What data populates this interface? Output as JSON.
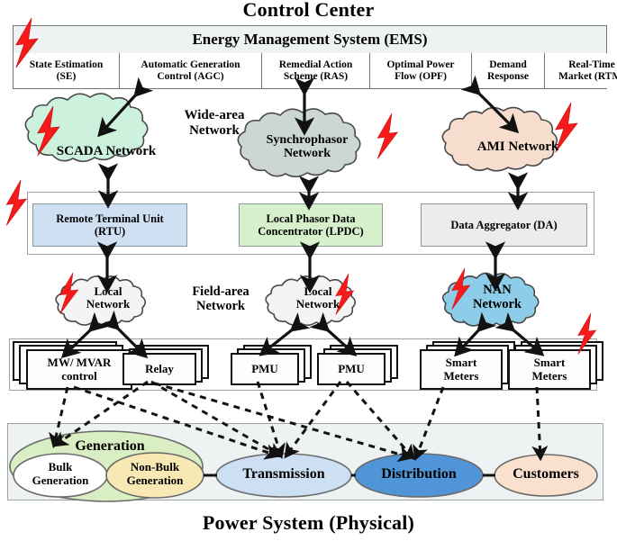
{
  "figure": {
    "top_title": "Control Center",
    "bottom_title": "Power System (Physical)"
  },
  "ems": {
    "header": "Energy Management System (EMS)",
    "modules": [
      {
        "label": "State Estimation\n(SE)",
        "line1": "State Estimation",
        "line2": "(SE)"
      },
      {
        "label": "Automatic Generation Control  (AGC)",
        "line1": "Automatic Generation",
        "line2": "Control  (AGC)"
      },
      {
        "label": "Remedial Action Scheme  (RAS)",
        "line1": "Remedial Action",
        "line2": "Scheme  (RAS)"
      },
      {
        "label": "Optimal Power Flow (OPF)",
        "line1": "Optimal Power",
        "line2": "Flow (OPF)"
      },
      {
        "label": "Demand Response",
        "line1": "Demand",
        "line2": "Response"
      },
      {
        "label": "Real-Time Market (RTM)",
        "line1": "Real-Time",
        "line2": "Market (RTM)"
      }
    ]
  },
  "wide_area": {
    "label_line1": "Wide-area",
    "label_line2": "Network",
    "clouds": [
      {
        "name": "SCADA Network",
        "line1": "SCADA Network",
        "line2": "",
        "color": "#ccf2dd"
      },
      {
        "name": "Synchrophasor Network",
        "line1": "Synchrophasor",
        "line2": "Network",
        "color": "#ccd6d4"
      },
      {
        "name": "AMI Network",
        "line1": "AMI Network",
        "line2": "",
        "color": "#f7ddcd"
      }
    ]
  },
  "substation_tier": {
    "nodes": [
      {
        "name": "Remote Terminal Unit (RTU)",
        "line1": "Remote Terminal Unit",
        "line2": "(RTU)",
        "color": "#cfe0f2"
      },
      {
        "name": "Local Phasor Data Concentrator (LPDC)",
        "line1": "Local Phasor Data",
        "line2": "Concentrator (LPDC)",
        "color": "#d6f0cb"
      },
      {
        "name": "Data Aggregator (DA)",
        "line1": "Data Aggregator (DA)",
        "line2": "",
        "color": "#ebeded"
      }
    ]
  },
  "field_area": {
    "label_line1": "Field-area",
    "label_line2": "Network",
    "clouds": [
      {
        "name": "Local Network",
        "line1": "Local",
        "line2": "Network",
        "color": "#f4f4f4"
      },
      {
        "name": "Local Network",
        "line1": "Local",
        "line2": "Network",
        "color": "#f4f4f4"
      },
      {
        "name": "NAN Network",
        "line1": "NAN",
        "line2": "Network",
        "color": "#8ecde9"
      }
    ]
  },
  "devices": [
    {
      "name": "MW/MVAR control",
      "line1": "MW/ MVAR",
      "line2": "control"
    },
    {
      "name": "Relay",
      "line1": "Relay",
      "line2": ""
    },
    {
      "name": "PMU",
      "line1": "PMU",
      "line2": ""
    },
    {
      "name": "PMU",
      "line1": "PMU",
      "line2": ""
    },
    {
      "name": "Smart Meters",
      "line1": "Smart",
      "line2": "Meters"
    },
    {
      "name": "Smart Meters",
      "line1": "Smart",
      "line2": "Meters"
    }
  ],
  "power_system": {
    "generation_group": "Generation",
    "stages": [
      {
        "name": "Bulk Generation",
        "line1": "Bulk",
        "line2": "Generation",
        "color": "#ffffff"
      },
      {
        "name": "Non-Bulk Generation",
        "line1": "Non-Bulk",
        "line2": "Generation",
        "color": "#f7e8b4"
      },
      {
        "name": "Transmission",
        "line1": "Transmission",
        "line2": "",
        "color": "#cddff2"
      },
      {
        "name": "Distribution",
        "line1": "Distribution",
        "line2": "",
        "color": "#4f95d8"
      },
      {
        "name": "Customers",
        "line1": "Customers",
        "line2": "",
        "color": "#fae0ce"
      }
    ],
    "generation_outer_color": "#d9eec2"
  },
  "attack_markers": {
    "icon": "lightning-bolt-icon",
    "color": "#f61a1a",
    "count": 9
  }
}
